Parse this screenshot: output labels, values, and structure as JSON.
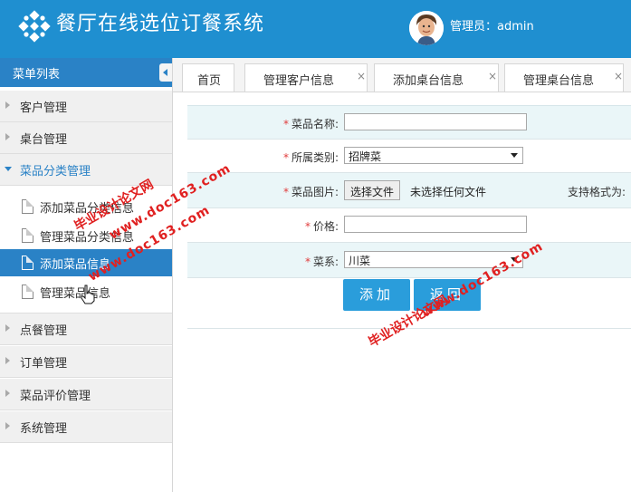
{
  "app": {
    "title": "餐厅在线选位订餐系统",
    "admin_label": "管理员：admin"
  },
  "sidebar": {
    "menu_title": "菜单列表",
    "groups": [
      {
        "label": "客户管理"
      },
      {
        "label": "桌台管理"
      },
      {
        "label": "菜品分类管理"
      },
      {
        "label": "点餐管理"
      },
      {
        "label": "订单管理"
      },
      {
        "label": "菜品评价管理"
      },
      {
        "label": "系统管理"
      }
    ],
    "sub_items": [
      {
        "label": "添加菜品分类信息"
      },
      {
        "label": "管理菜品分类信息"
      },
      {
        "label": "添加菜品信息"
      },
      {
        "label": "管理菜品信息"
      }
    ]
  },
  "tabs": [
    {
      "label": "首页"
    },
    {
      "label": "管理客户信息"
    },
    {
      "label": "添加桌台信息"
    },
    {
      "label": "管理桌台信息"
    }
  ],
  "form": {
    "dish_name_label": "菜品名称:",
    "dish_name_value": "",
    "category_label": "所属类别:",
    "category_value": "招牌菜",
    "image_label": "菜品图片:",
    "file_button": "选择文件",
    "file_status": "未选择任何文件",
    "support_formats": "支持格式为:",
    "price_label": "价格:",
    "price_value": "",
    "cuisine_label": "菜系:",
    "cuisine_value": "川菜",
    "add_button": "添加",
    "back_button": "返回"
  },
  "watermark": {
    "line1": "毕业设计论文网",
    "line2": "www.doc163.com"
  },
  "colors": {
    "header": "#1f8fd0",
    "active": "#2a82c6",
    "button": "#2a9ddb",
    "required": "#e03c3c"
  }
}
